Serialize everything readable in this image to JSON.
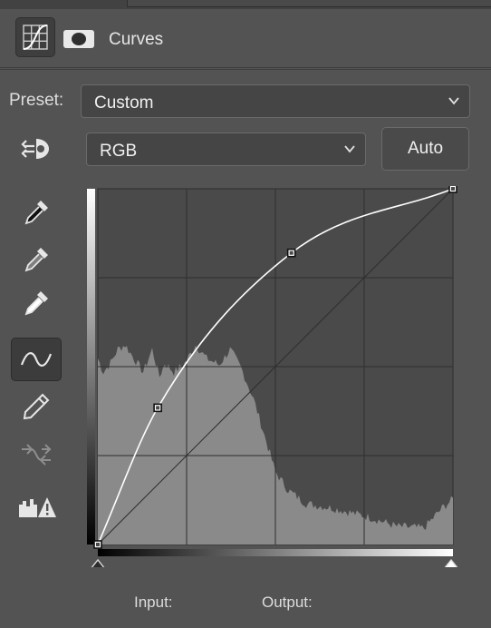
{
  "panel": {
    "title": "Curves",
    "preset_label": "Preset:",
    "preset_value": "Custom",
    "channel_value": "RGB",
    "auto_label": "Auto",
    "input_label": "Input:",
    "output_label": "Output:"
  },
  "tools": [
    {
      "name": "target-adjust-tool-icon",
      "active": false
    },
    {
      "name": "sample-black-point-eyedropper-icon",
      "active": false
    },
    {
      "name": "sample-gray-point-eyedropper-icon",
      "active": false
    },
    {
      "name": "sample-white-point-eyedropper-icon",
      "active": false
    },
    {
      "name": "edit-points-curve-icon",
      "active": true
    },
    {
      "name": "draw-pencil-icon",
      "active": false
    },
    {
      "name": "smooth-curve-icon",
      "active": false
    },
    {
      "name": "clipping-warning-icon",
      "active": false
    }
  ],
  "curve": {
    "points": [
      [
        0,
        0
      ],
      [
        43,
        98
      ],
      [
        139,
        209
      ],
      [
        255,
        255
      ]
    ],
    "range": [
      0,
      255
    ]
  },
  "colors": {
    "panel_bg": "#535353",
    "graph_bg": "#4a4a4a",
    "histogram": "#8a8a8a",
    "curve": "#ffffff"
  }
}
